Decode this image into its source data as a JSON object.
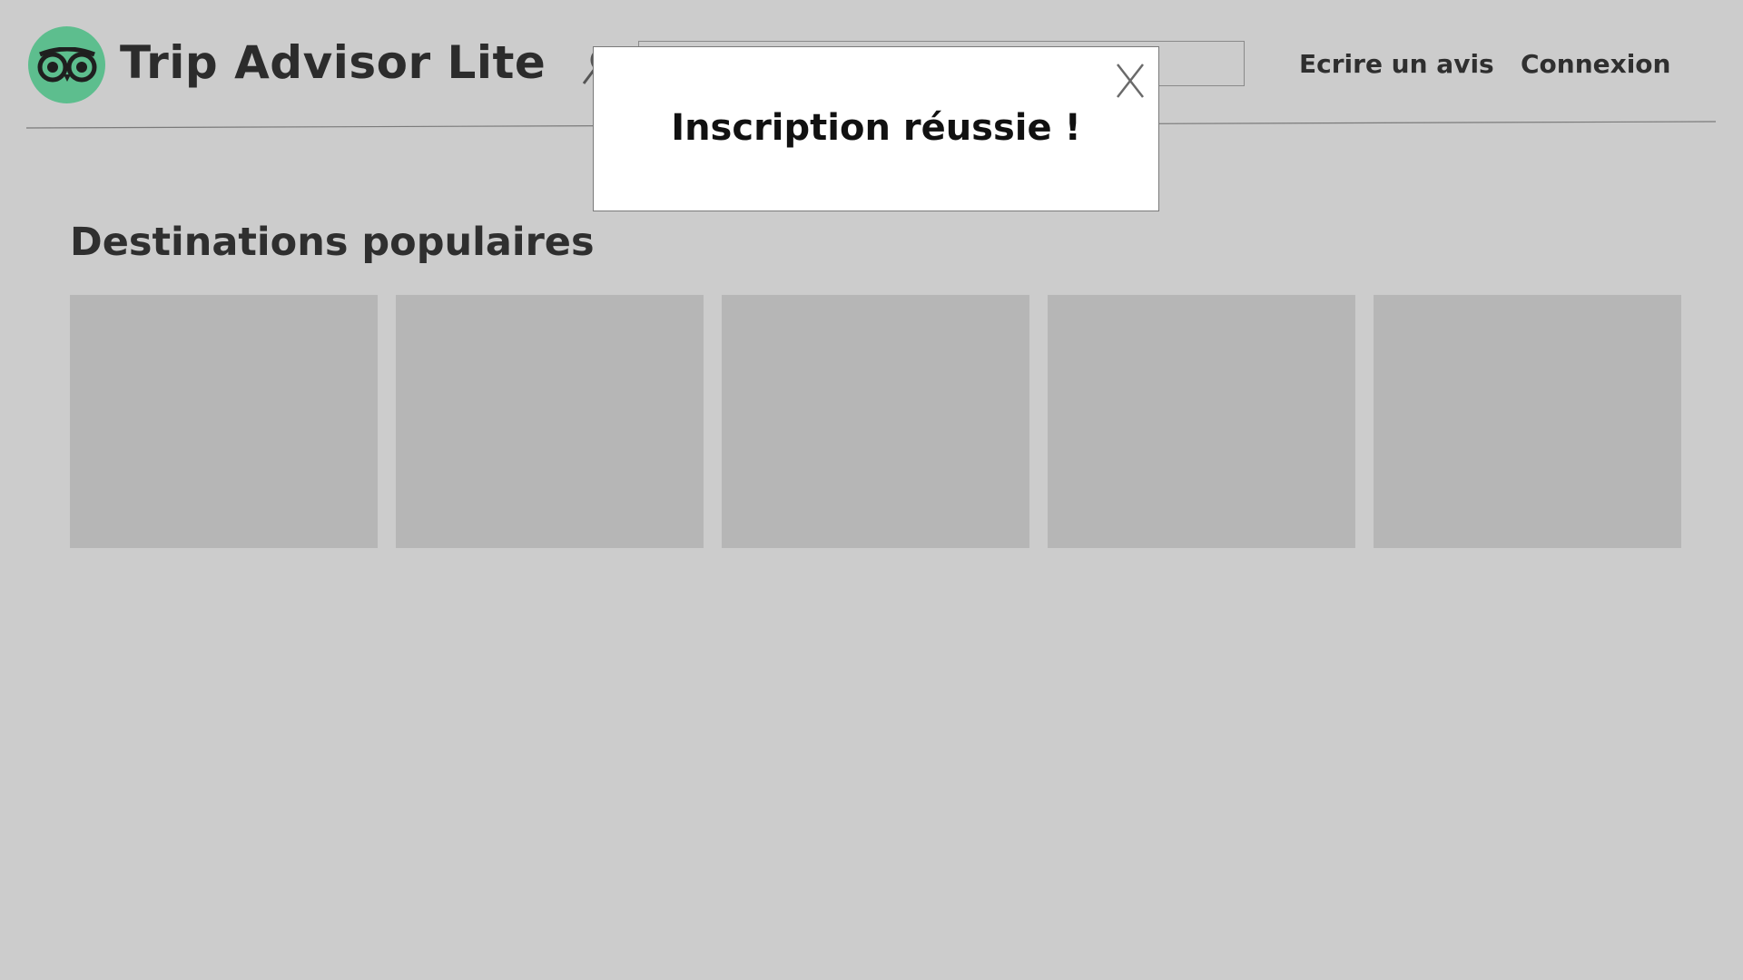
{
  "app": {
    "title": "Trip Advisor Lite",
    "logo_icon": "owl-eyes-icon",
    "brand_color": "#5dbe8e"
  },
  "header": {
    "search": {
      "icon": "search-icon",
      "value": "",
      "placeholder": ""
    },
    "nav": {
      "write_review": "Ecrire un avis",
      "login": "Connexion"
    }
  },
  "main": {
    "section_title": "Destinations populaires",
    "destination_cards": [
      {
        "label": ""
      },
      {
        "label": ""
      },
      {
        "label": ""
      },
      {
        "label": ""
      },
      {
        "label": ""
      }
    ]
  },
  "modal": {
    "message": "Inscription réussie !",
    "close_icon": "close-icon"
  }
}
